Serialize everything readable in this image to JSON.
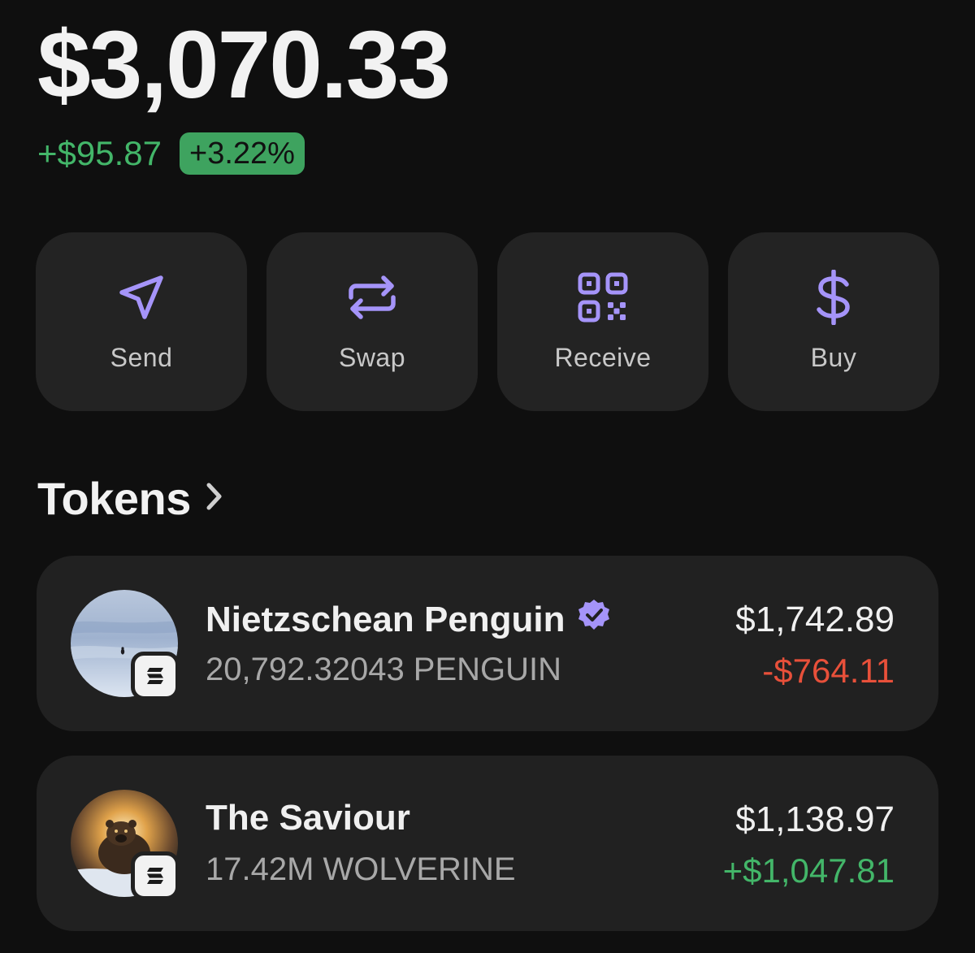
{
  "wallet": {
    "balance": "$3,070.33",
    "change_amount": "+$95.87",
    "change_percent": "+3.22%",
    "positive_color": "#43b669",
    "negative_color": "#e8503a",
    "accent_color": "#a594f9"
  },
  "actions": [
    {
      "label": "Send",
      "icon": "send-icon"
    },
    {
      "label": "Swap",
      "icon": "swap-icon"
    },
    {
      "label": "Receive",
      "icon": "qr-code-icon"
    },
    {
      "label": "Buy",
      "icon": "dollar-icon"
    }
  ],
  "tokens_section": {
    "title": "Tokens",
    "icon": "chevron-right-icon"
  },
  "tokens": [
    {
      "name": "Nietzschean Penguin",
      "verified": true,
      "amount": "20,792.32043 PENGUIN",
      "value": "$1,742.89",
      "change": "-$764.11",
      "change_direction": "negative",
      "avatar": "penguin-avatar",
      "chain_badge": "solana-icon"
    },
    {
      "name": "The Saviour",
      "verified": false,
      "amount": "17.42M WOLVERINE",
      "value": "$1,138.97",
      "change": "+$1,047.81",
      "change_direction": "positive",
      "avatar": "wolverine-avatar",
      "chain_badge": "solana-icon"
    }
  ]
}
